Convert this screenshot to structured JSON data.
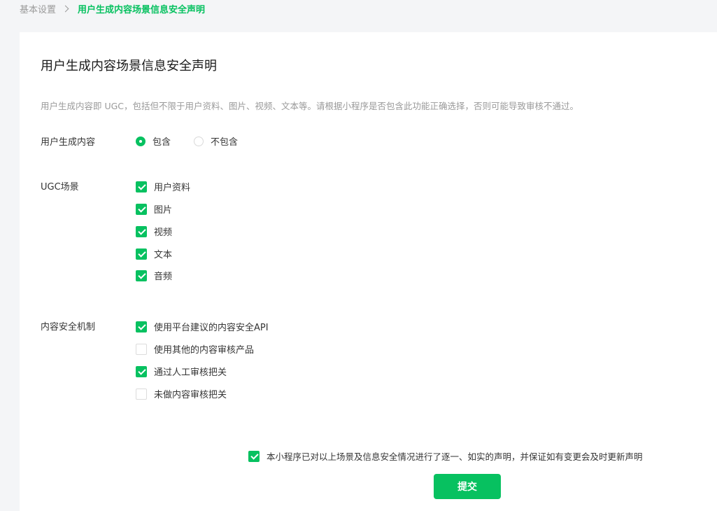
{
  "breadcrumb": {
    "parent": "基本设置",
    "current": "用户生成内容场景信息安全声明"
  },
  "page": {
    "title": "用户生成内容场景信息安全声明",
    "description": "用户生成内容即 UGC，包括但不限于用户资料、图片、视频、文本等。请根据小程序是否包含此功能正确选择，否则可能导致审核不通过。"
  },
  "ugc_content": {
    "label": "用户生成内容",
    "options": [
      {
        "label": "包含",
        "selected": true
      },
      {
        "label": "不包含",
        "selected": false
      }
    ]
  },
  "ugc_scenes": {
    "label": "UGC场景",
    "options": [
      {
        "label": "用户资料",
        "checked": true
      },
      {
        "label": "图片",
        "checked": true
      },
      {
        "label": "视频",
        "checked": true
      },
      {
        "label": "文本",
        "checked": true
      },
      {
        "label": "音频",
        "checked": true
      }
    ]
  },
  "security_mechanism": {
    "label": "内容安全机制",
    "options": [
      {
        "label": "使用平台建议的内容安全API",
        "checked": true
      },
      {
        "label": "使用其他的内容审核产品",
        "checked": false
      },
      {
        "label": "通过人工审核把关",
        "checked": true
      },
      {
        "label": "未做内容审核把关",
        "checked": false
      }
    ]
  },
  "agreement": {
    "label": "本小程序已对以上场景及信息安全情况进行了逐一、如实的声明，并保证如有变更会及时更新声明",
    "checked": true
  },
  "submit_label": "提交",
  "colors": {
    "accent": "#07c160",
    "page_background": "#f4f5f7",
    "muted_text": "#9a9a9a"
  }
}
